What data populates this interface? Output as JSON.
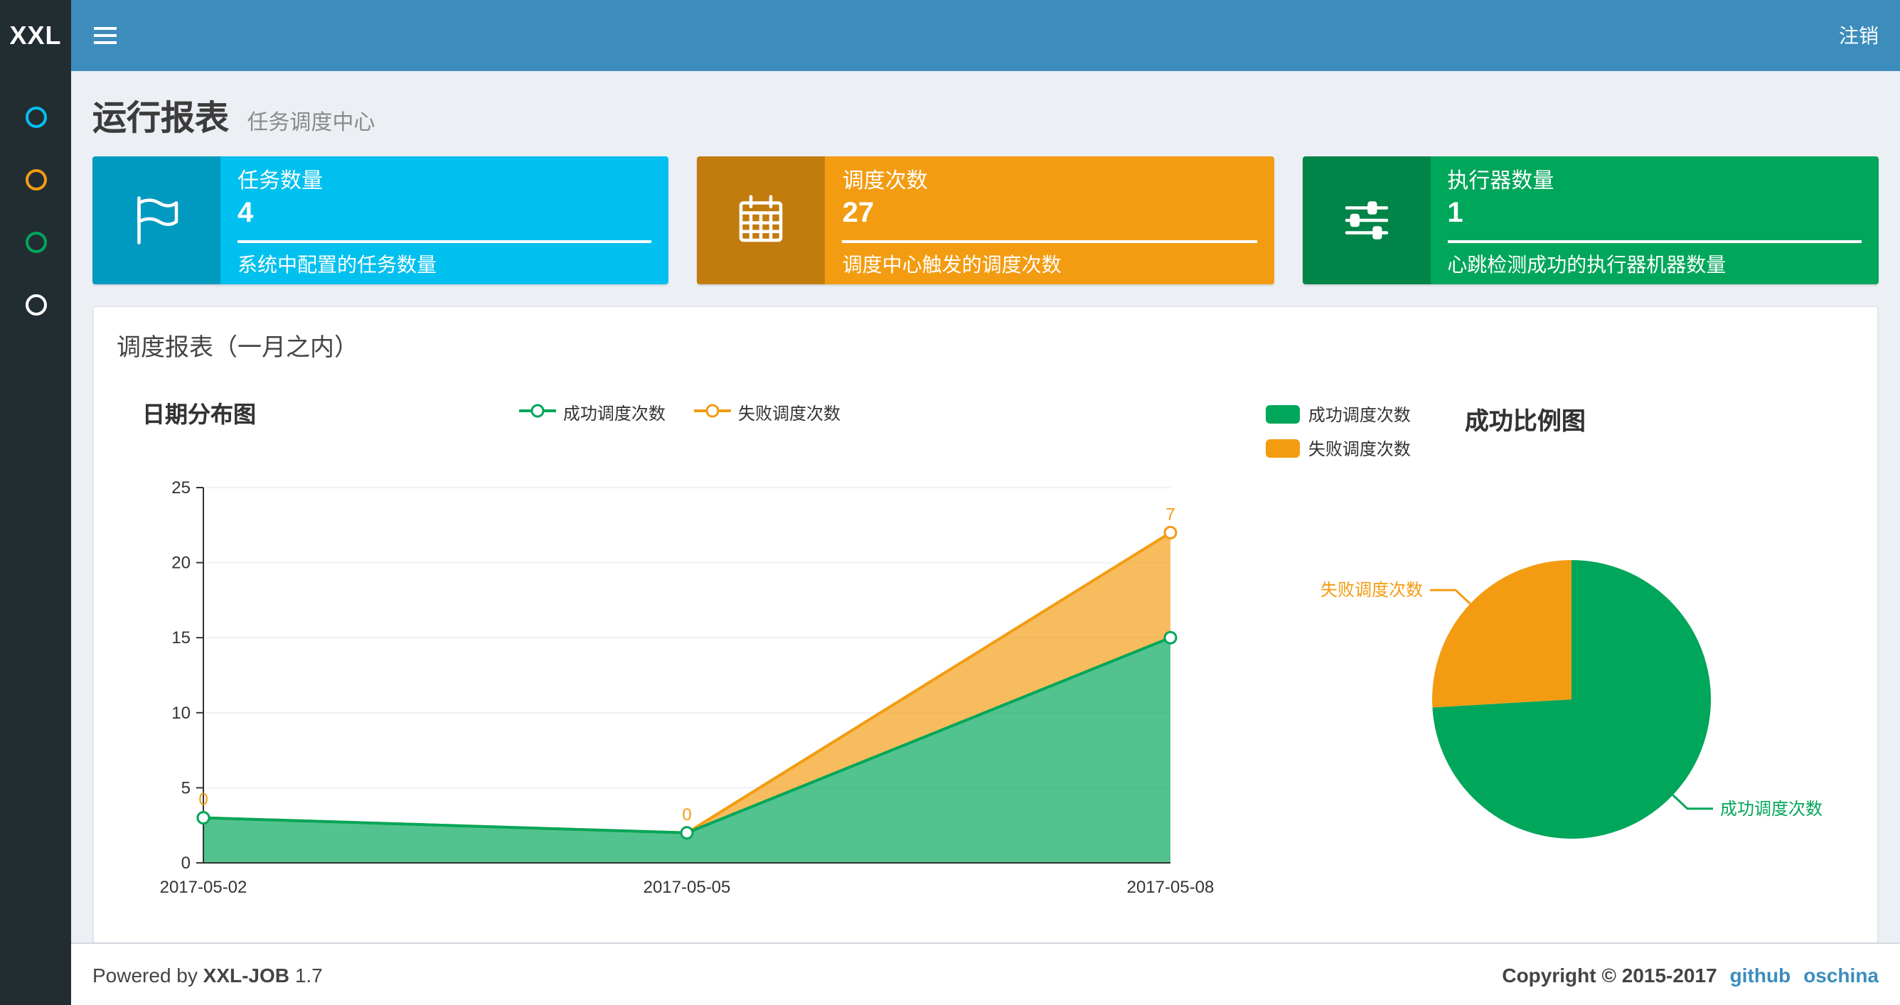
{
  "navbar": {
    "logo": "XXL",
    "logout": "注销"
  },
  "sidebar": {
    "items": [
      {
        "color": "#00c0ef"
      },
      {
        "color": "#f39c12"
      },
      {
        "color": "#00a65a"
      },
      {
        "color": "#ffffff"
      }
    ]
  },
  "header": {
    "title": "运行报表",
    "subtitle": "任务调度中心"
  },
  "info_boxes": [
    {
      "label": "任务数量",
      "value": "4",
      "description": "系统中配置的任务数量",
      "color": "#00c0ef",
      "icon": "flag-icon"
    },
    {
      "label": "调度次数",
      "value": "27",
      "description": "调度中心触发的调度次数",
      "color": "#f39c12",
      "icon": "calendar-icon"
    },
    {
      "label": "执行器数量",
      "value": "1",
      "description": "心跳检测成功的执行器机器数量",
      "color": "#00a65a",
      "icon": "sliders-icon"
    }
  ],
  "panel": {
    "title": "调度报表（一月之内）"
  },
  "chart_data": [
    {
      "type": "area",
      "title": "日期分布图",
      "categories": [
        "2017-05-02",
        "2017-05-05",
        "2017-05-08"
      ],
      "series": [
        {
          "name": "成功调度次数",
          "color": "#00a65a",
          "values": [
            3,
            2,
            15
          ]
        },
        {
          "name": "失败调度次数",
          "color": "#f39c12",
          "values": [
            0,
            0,
            7
          ]
        }
      ],
      "stacked": true,
      "ylim": [
        0,
        25
      ],
      "ytick": 5,
      "grid": true,
      "legend_position": "top-center",
      "point_labels_series": "失败调度次数",
      "point_labels": [
        "0",
        "0",
        "7"
      ]
    },
    {
      "type": "pie",
      "title": "成功比例图",
      "slices": [
        {
          "name": "成功调度次数",
          "value": 20,
          "color": "#00a65a"
        },
        {
          "name": "失败调度次数",
          "value": 7,
          "color": "#f39c12"
        }
      ],
      "legend_position": "top-left"
    }
  ],
  "footer": {
    "powered_prefix": "Powered by",
    "product": "XXL-JOB",
    "version": "1.7",
    "copyright": "Copyright © 2015-2017",
    "links": [
      "github",
      "oschina"
    ]
  },
  "colors": {
    "navbar": "#3c8dbc",
    "sidebar": "#222d32",
    "background": "#ecf0f5",
    "link": "#3c8dbc",
    "success": "#00a65a",
    "warning": "#f39c12",
    "info": "#00c0ef"
  }
}
